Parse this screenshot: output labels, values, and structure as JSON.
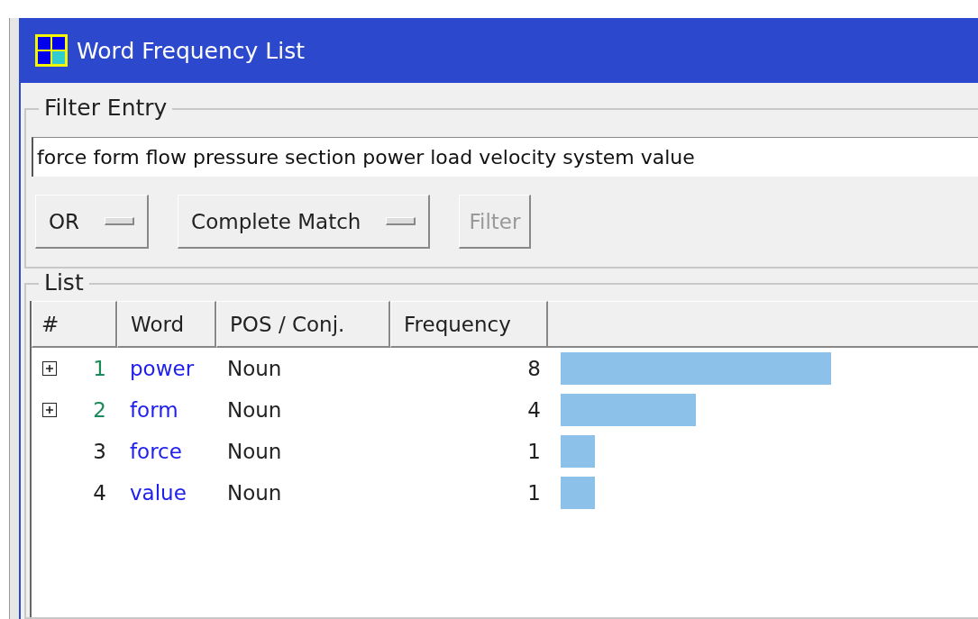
{
  "window": {
    "title": "Word Frequency List"
  },
  "filter_entry": {
    "label": "Filter Entry",
    "value": "force form flow pressure section power load velocity system value",
    "controls": [
      {
        "kind": "dropdown",
        "label": "OR",
        "disabled": false
      },
      {
        "kind": "dropdown",
        "label": "Complete Match",
        "disabled": false
      },
      {
        "kind": "button",
        "label": "Filter",
        "disabled": true
      }
    ]
  },
  "list": {
    "label": "List",
    "columns": [
      "#",
      "Word",
      "POS / Conj.",
      "Frequency"
    ],
    "rows": [
      {
        "expandable": true,
        "number": "1",
        "word": "power",
        "pos": "Noun",
        "frequency": "8"
      },
      {
        "expandable": true,
        "number": "2",
        "word": "form",
        "pos": "Noun",
        "frequency": "4"
      },
      {
        "expandable": false,
        "number": "3",
        "word": "force",
        "pos": "Noun",
        "frequency": "1"
      },
      {
        "expandable": false,
        "number": "4",
        "word": "value",
        "pos": "Noun",
        "frequency": "1"
      }
    ]
  }
}
